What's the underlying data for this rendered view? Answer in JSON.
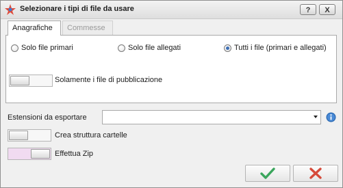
{
  "window": {
    "title": "Selezionare i tipi di file da usare",
    "help_button": "?",
    "close_button": "X"
  },
  "tabs": [
    {
      "label": "Anagrafiche",
      "active": true
    },
    {
      "label": "Commesse",
      "active": false
    }
  ],
  "file_type": {
    "options": [
      {
        "label": "Solo file primari",
        "checked": false
      },
      {
        "label": "Solo file allegati",
        "checked": false
      },
      {
        "label": "Tutti i file (primari e allegati)",
        "checked": true
      }
    ]
  },
  "publication_only": {
    "label": "Solamente i file di pubblicazione",
    "on": false
  },
  "extensions": {
    "label": "Estensioni da esportare",
    "value": ""
  },
  "folder_structure": {
    "label": "Crea struttura cartelle",
    "on": false
  },
  "zip": {
    "label": "Effettua Zip",
    "on": true
  },
  "icons": {
    "app": "app-logo-icon",
    "info": "info-icon",
    "ok": "checkmark-icon",
    "cancel": "cross-icon"
  },
  "colors": {
    "ok_green": "#3aa55c",
    "cancel_red": "#d64a3a",
    "info_blue": "#2f6db5",
    "toggle_on": "#f1dbf1"
  }
}
